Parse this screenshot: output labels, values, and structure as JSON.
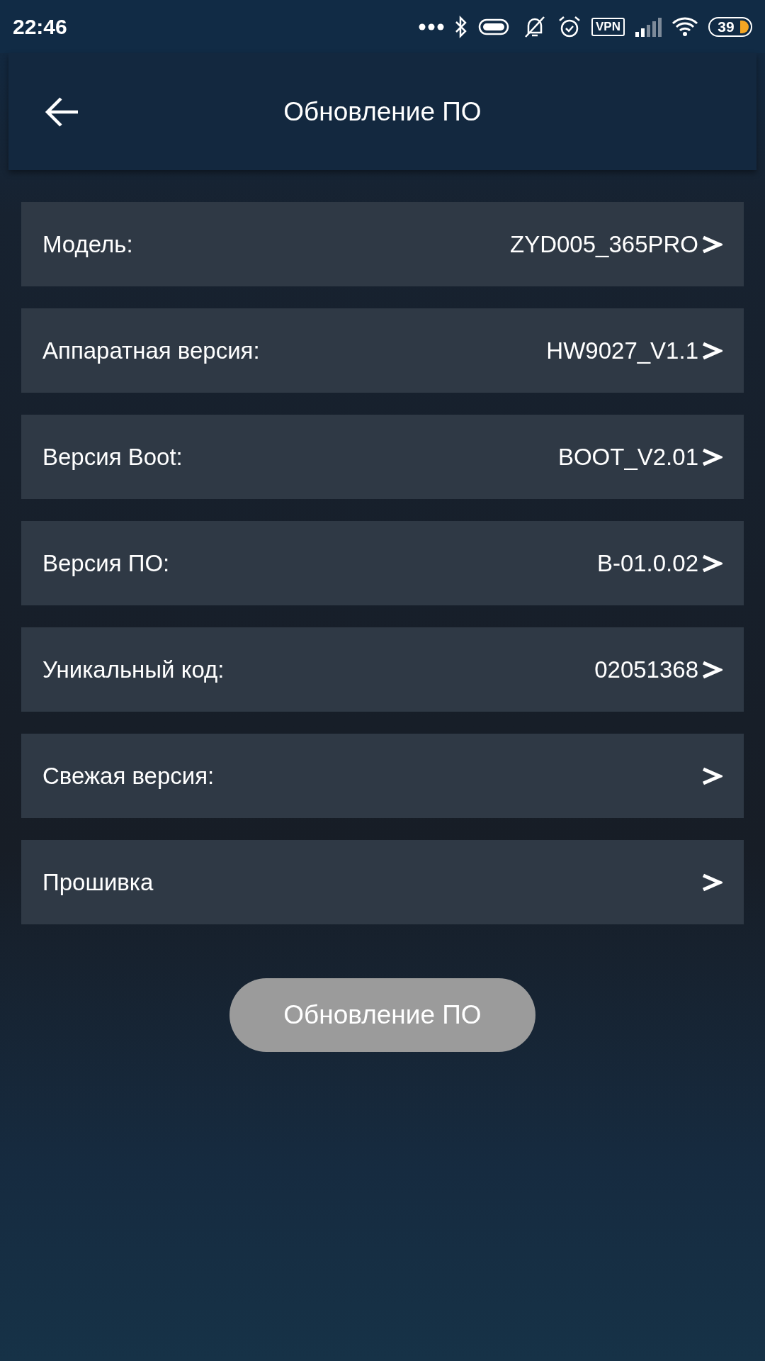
{
  "status_bar": {
    "time": "22:46",
    "vpn": "VPN",
    "battery": "39"
  },
  "header": {
    "title": "Обновление ПО"
  },
  "rows": [
    {
      "label": "Модель:",
      "value": "ZYD005_365PRO"
    },
    {
      "label": "Аппаратная версия:",
      "value": "HW9027_V1.1"
    },
    {
      "label": "Версия Boot:",
      "value": "BOOT_V2.01"
    },
    {
      "label": "Версия ПО:",
      "value": "B-01.0.02"
    },
    {
      "label": "Уникальный код:",
      "value": "02051368"
    },
    {
      "label": "Свежая версия:"
    },
    {
      "label": "Прошивка"
    }
  ],
  "update_button": {
    "label": "Обновление ПО",
    "disabled": true
  }
}
